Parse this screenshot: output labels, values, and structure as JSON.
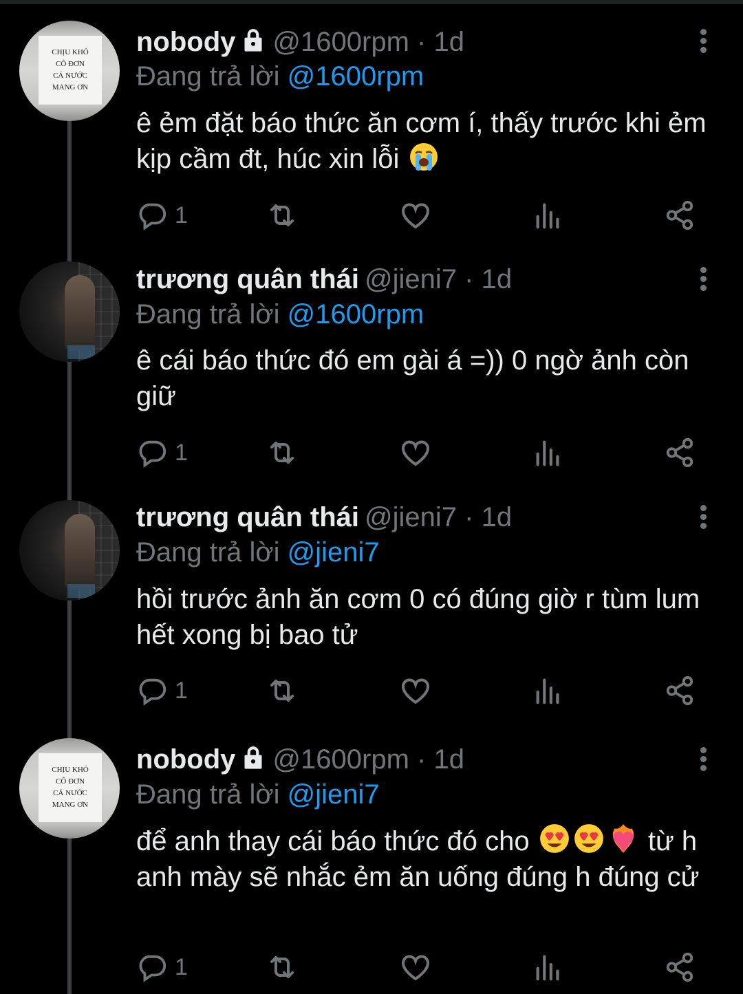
{
  "colors": {
    "background": "#000000",
    "text": "#e7e9ea",
    "muted": "#71767b",
    "accent": "#1d9bf0"
  },
  "tweets": [
    {
      "avatar": "sign-avatar",
      "avatar_sign_lines": [
        "CHỊU KHÓ",
        "CÔ ĐƠN",
        "CÁ NƯỚC",
        "MANG ƠN"
      ],
      "name": "nobody",
      "protected": true,
      "handle": "@1600rpm",
      "time": "1d",
      "reply_prefix": "Đang trả lời",
      "reply_to": "@1600rpm",
      "text": "ê ẻm đặt báo thức ăn cơm í, thấy trước khi ẻm kịp cầm đt, húc xin lỗi",
      "emoji": [
        "loudly-crying-face"
      ],
      "reply_count": "1"
    },
    {
      "avatar": "photo-avatar",
      "name": "trương quân thái",
      "protected": false,
      "handle": "@jieni7",
      "time": "1d",
      "reply_prefix": "Đang trả lời",
      "reply_to": "@1600rpm",
      "text": "ê cái báo thức đó em gài á =)) 0 ngờ ảnh còn giữ",
      "reply_count": "1"
    },
    {
      "avatar": "photo-avatar",
      "name": "trương quân thái",
      "protected": false,
      "handle": "@jieni7",
      "time": "1d",
      "reply_prefix": "Đang trả lời",
      "reply_to": "@jieni7",
      "text": "hồi trước ảnh ăn cơm 0 có đúng giờ r tùm lum hết xong bị bao tử",
      "reply_count": "1"
    },
    {
      "avatar": "sign-avatar",
      "avatar_sign_lines": [
        "CHỊU KHÓ",
        "CÔ ĐƠN",
        "CÁ NƯỚC",
        "MANG ƠN"
      ],
      "name": "nobody",
      "protected": true,
      "handle": "@1600rpm",
      "time": "1d",
      "reply_prefix": "Đang trả lời",
      "reply_to": "@jieni7",
      "text_before": "để anh thay cái báo thức đó cho",
      "emoji": [
        "smiling-face-with-heart-eyes",
        "smiling-face-with-heart-eyes",
        "heart-on-fire"
      ],
      "text_after": "từ h anh mày sẽ nhắc ẻm ăn uống đúng h đúng cử",
      "reply_count": "1"
    }
  ]
}
